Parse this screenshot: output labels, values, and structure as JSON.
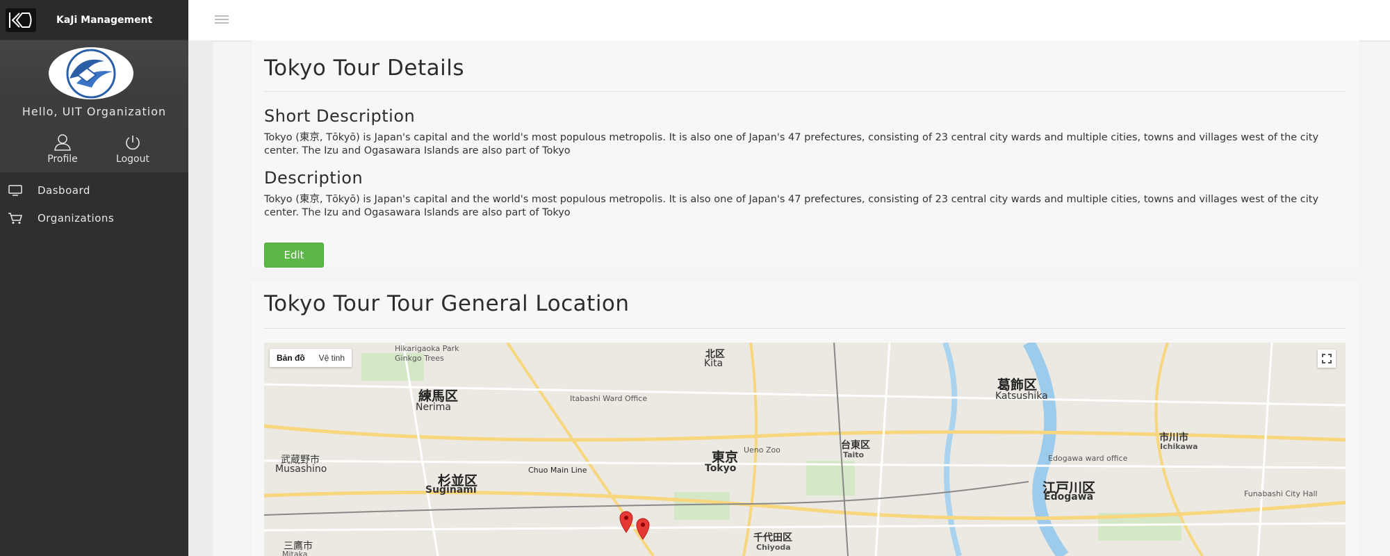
{
  "brand": {
    "name": "KaJi Management"
  },
  "user": {
    "greeting": "Hello, UIT Organization",
    "profile_label": "Profile",
    "logout_label": "Logout"
  },
  "nav": {
    "items": [
      {
        "label": "Dasboard",
        "icon": "monitor-icon"
      },
      {
        "label": "Organizations",
        "icon": "cart-icon"
      }
    ]
  },
  "details": {
    "title": "Tokyo Tour Details",
    "short_heading": "Short Description",
    "short_text": "Tokyo (東京, Tōkyō) is Japan's capital and the world's most populous metropolis. It is also one of Japan's 47 prefectures, consisting of 23 central city wards and multiple cities, towns and villages west of the city center. The Izu and Ogasawara Islands are also part of Tokyo",
    "desc_heading": "Description",
    "desc_text": "Tokyo (東京, Tōkyō) is Japan's capital and the world's most populous metropolis. It is also one of Japan's 47 prefectures, consisting of 23 central city wards and multiple cities, towns and villages west of the city center. The Izu and Ogasawara Islands are also part of Tokyo",
    "edit_label": "Edit"
  },
  "location": {
    "title": "Tokyo Tour Tour General Location",
    "map_types": [
      "Bản đồ",
      "Vệ tinh"
    ],
    "labels": {
      "nerima_jp": "練馬区",
      "nerima": "Nerima",
      "suginami_jp": "杉並区",
      "suginami": "Suginami",
      "tokyo_jp": "東京",
      "tokyo": "Tokyo",
      "katsushika_jp": "葛飾区",
      "katsushika": "Katsushika",
      "edogawa_jp": "江戸川区",
      "edogawa": "Edogawa",
      "ichikawa_jp": "市川市",
      "ichikawa": "Ichikawa",
      "kita_jp": "北区",
      "kita": "Kita",
      "taito_jp": "台東区",
      "taito": "Taito",
      "chiyoda_jp": "千代田区",
      "chiyoda": "Chiyoda",
      "musashino_jp": "武蔵野市",
      "musashino": "Musashino",
      "mitaka_jp": "三鷹市",
      "mitaka": "Mitaka",
      "ueno_zoo": "Ueno Zoo",
      "itabashi": "Itabashi Ward Office",
      "chuo_line": "Chuo Main Line",
      "hikarigaoka": "Hikarigaoka Park Ginkgo Trees",
      "funabashi": "Funabashi City Hall",
      "edogawa_office": "Edogawa ward office"
    }
  },
  "colors": {
    "sidebar": "#2f2f2f",
    "accent_green": "#5cb748",
    "pin_red": "#e53935"
  }
}
